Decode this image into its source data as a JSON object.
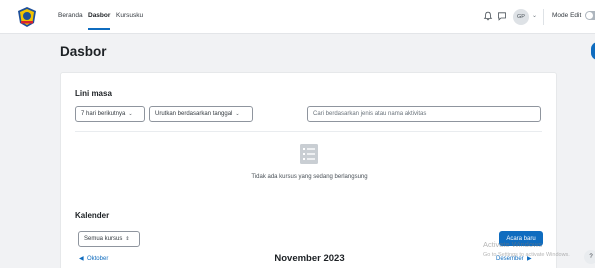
{
  "navbar": {
    "links": [
      "Beranda",
      "Dasbor",
      "Kursusku"
    ],
    "avatar_initials": "GP",
    "mode_edit_label": "Mode Edit",
    "icons": [
      "notification-bell-icon",
      "chat-icon",
      "chevron-down-icon"
    ]
  },
  "page": {
    "title": "Dasbor"
  },
  "timeline": {
    "title": "Lini masa",
    "filter_days": "7 hari berikutnya",
    "sort": "Urutkan berdasarkan tanggal",
    "search_placeholder": "Cari berdasarkan jenis atau nama aktivitas",
    "empty_message": "Tidak ada kursus yang sedang berlangsung"
  },
  "calendar": {
    "title": "Kalender",
    "course_select": "Semua kursus",
    "new_event_label": "Acara baru",
    "prev_month": "Oktober",
    "current_month": "November 2023",
    "next_month": "Desember"
  },
  "watermark": {
    "line1": "Activate Windows",
    "line2": "Go to Settings to activate Windows."
  },
  "help_label": "?",
  "colors": {
    "primary": "#0f6cbf",
    "background": "#f1f2f4",
    "card": "#ffffff"
  }
}
